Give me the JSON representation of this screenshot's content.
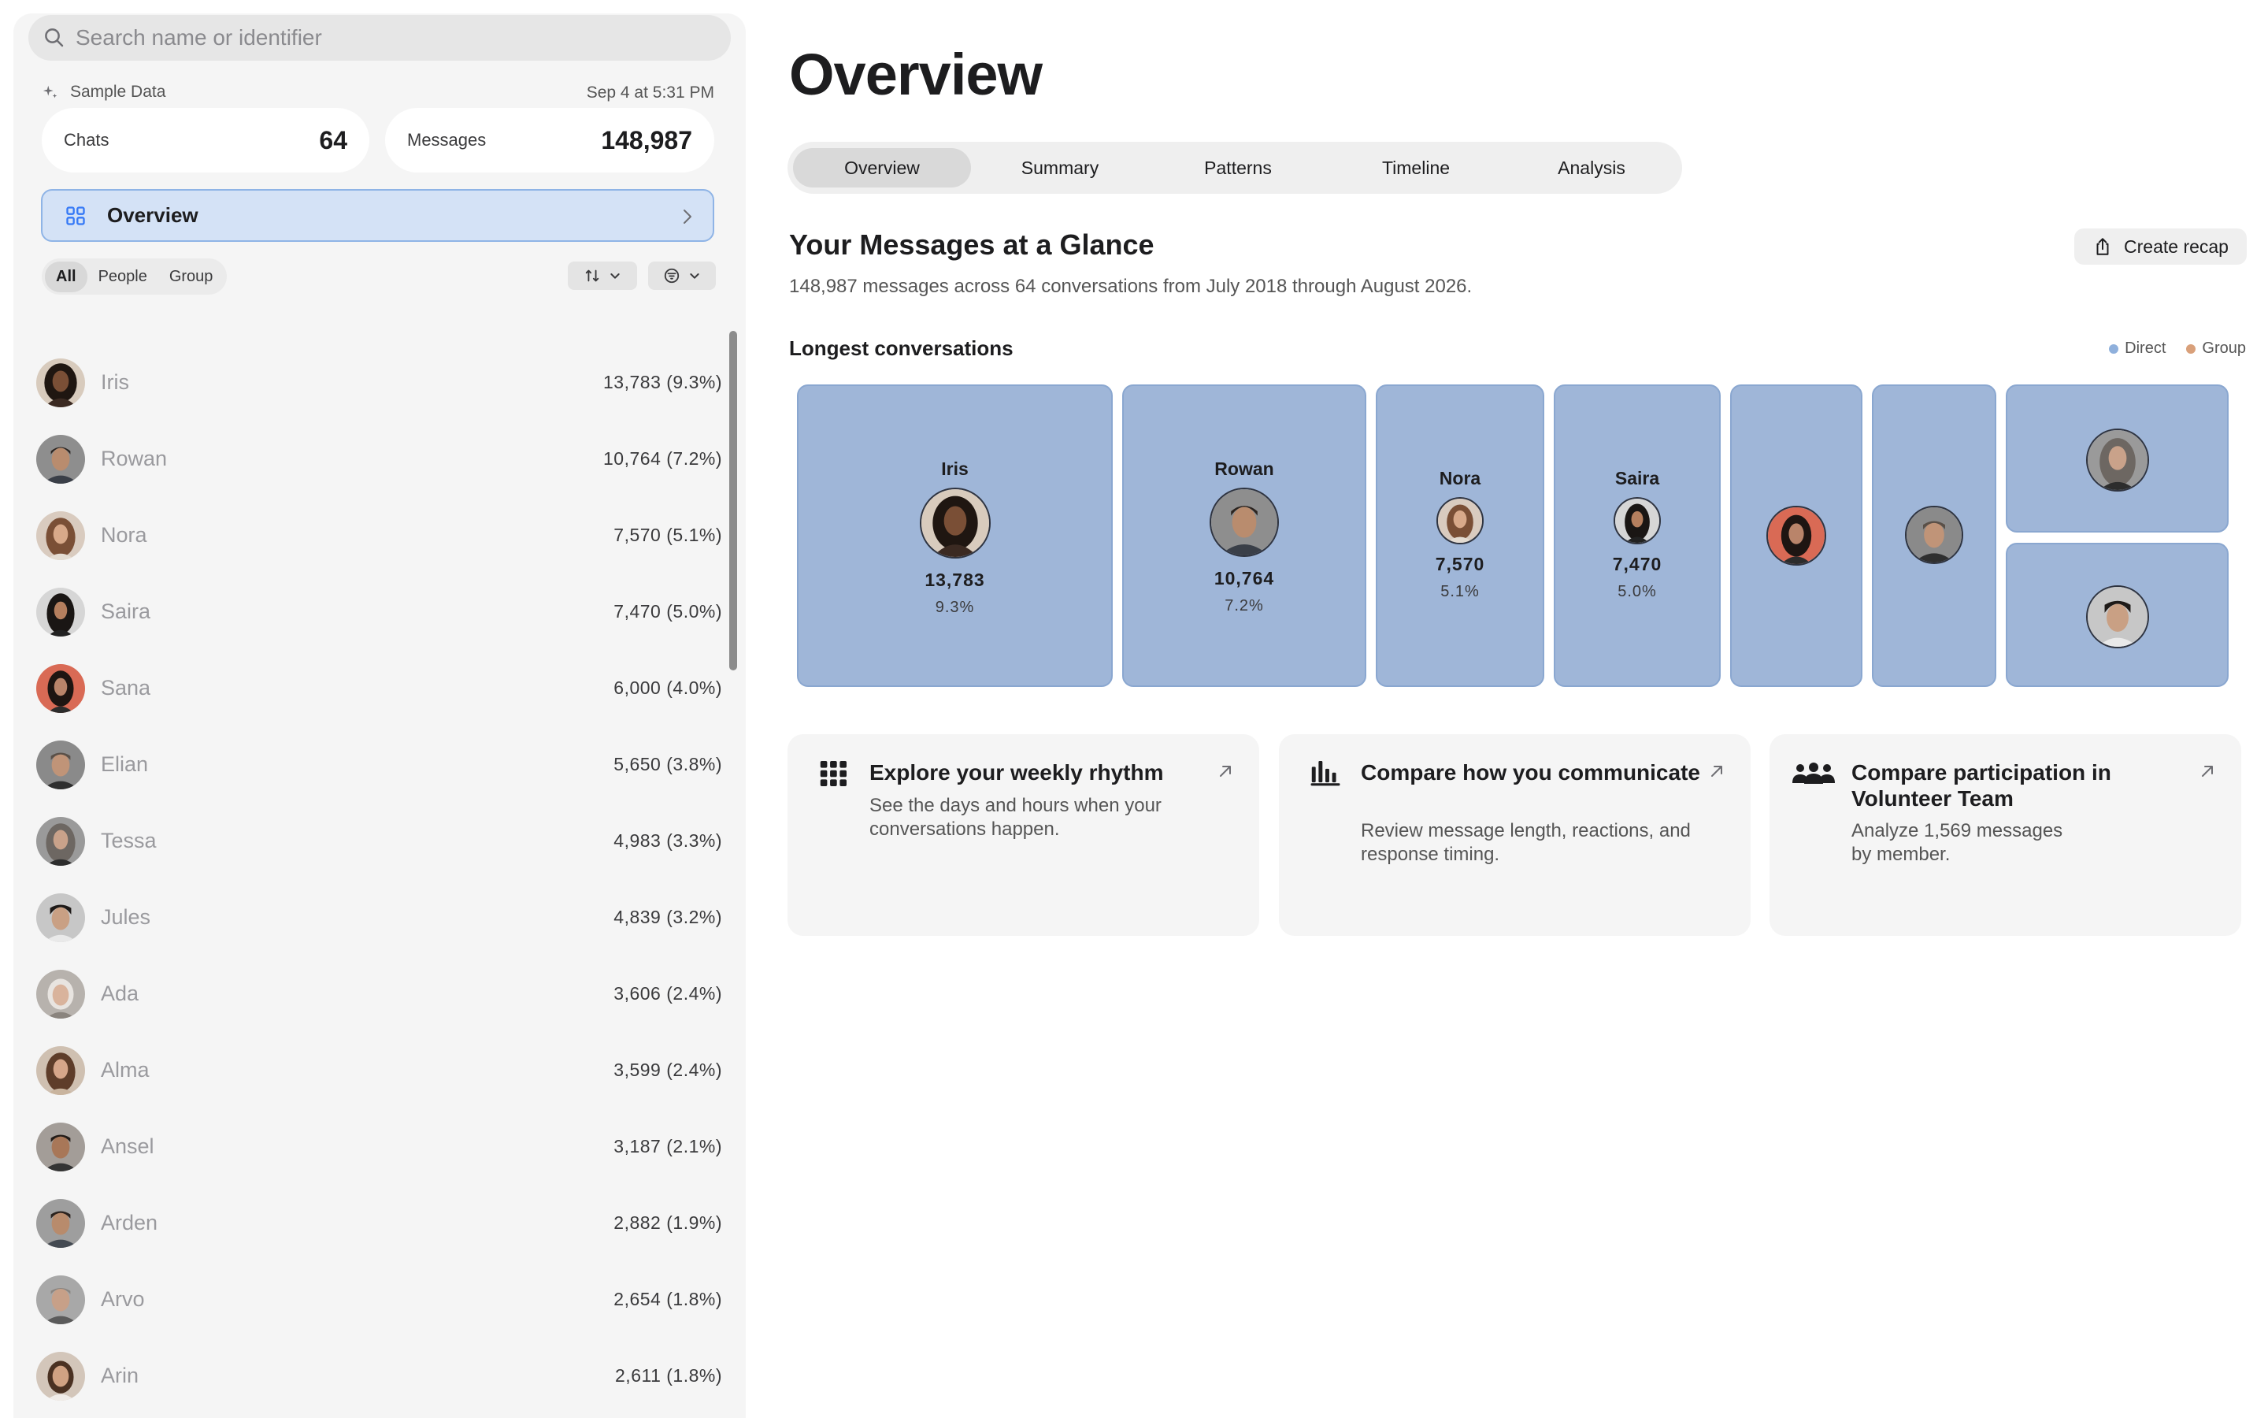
{
  "sidebar": {
    "search": {
      "placeholder": "Search name or identifier",
      "icon": "search-icon"
    },
    "source_label": "Sample Data",
    "timestamp": "Sep 4 at 5:31 PM",
    "stats": {
      "chats_label": "Chats",
      "chats_value": "64",
      "messages_label": "Messages",
      "messages_value": "148,987"
    },
    "overview_label": "Overview",
    "filters": [
      "All",
      "People",
      "Group"
    ],
    "active_filter": "All",
    "contacts": [
      {
        "name": "Iris",
        "count": "13,783 (9.3%)"
      },
      {
        "name": "Rowan",
        "count": "10,764 (7.2%)"
      },
      {
        "name": "Nora",
        "count": "7,570 (5.1%)"
      },
      {
        "name": "Saira",
        "count": "7,470 (5.0%)"
      },
      {
        "name": "Sana",
        "count": "6,000 (4.0%)"
      },
      {
        "name": "Elian",
        "count": "5,650 (3.8%)"
      },
      {
        "name": "Tessa",
        "count": "4,983 (3.3%)"
      },
      {
        "name": "Jules",
        "count": "4,839 (3.2%)"
      },
      {
        "name": "Ada",
        "count": "3,606 (2.4%)"
      },
      {
        "name": "Alma",
        "count": "3,599 (2.4%)"
      },
      {
        "name": "Ansel",
        "count": "3,187 (2.1%)"
      },
      {
        "name": "Arden",
        "count": "2,882 (1.9%)"
      },
      {
        "name": "Arvo",
        "count": "2,654 (1.8%)"
      },
      {
        "name": "Arin",
        "count": "2,611 (1.8%)"
      }
    ]
  },
  "main": {
    "title": "Overview",
    "tabs": [
      "Overview",
      "Summary",
      "Patterns",
      "Timeline",
      "Analysis"
    ],
    "active_tab": "Overview",
    "glance_title": "Your Messages at a Glance",
    "glance_subtitle": "148,987 messages across 64 conversations from July 2018 through August 2026.",
    "create_recap_label": "Create recap",
    "longest_title": "Longest conversations",
    "legend": {
      "direct": "Direct",
      "group": "Group"
    },
    "treemap": [
      {
        "name": "Iris",
        "value": "13,783",
        "pct": "9.3%"
      },
      {
        "name": "Rowan",
        "value": "10,764",
        "pct": "7.2%"
      },
      {
        "name": "Nora",
        "value": "7,570",
        "pct": "5.1%"
      },
      {
        "name": "Saira",
        "value": "7,470",
        "pct": "5.0%"
      }
    ],
    "cards": [
      {
        "title": "Explore your weekly rhythm",
        "desc": "See the days and hours when your conversations happen.",
        "icon": "grid-dots-icon"
      },
      {
        "title": "Compare how you communicate",
        "desc": "Review message length, reactions, and response timing.",
        "icon": "bar-chart-icon"
      },
      {
        "title": "Compare participation in Volunteer Team",
        "desc": "Analyze 1,569 messages by member.",
        "icon": "people-icon"
      }
    ]
  },
  "colors": {
    "accent": "#d4e2f6",
    "treemap_fill": "#9fb6d8",
    "direct": "#8fb0dc",
    "group": "#d9a07a"
  }
}
